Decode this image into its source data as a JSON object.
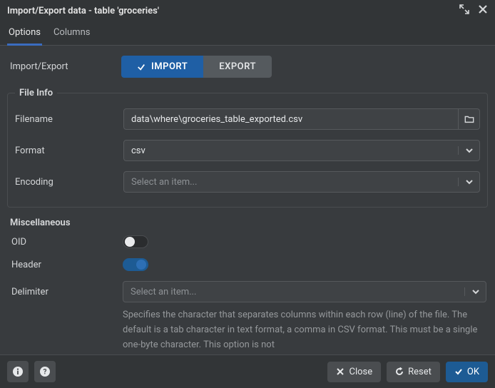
{
  "title": "Import/Export data - table 'groceries'",
  "tabs": {
    "options": "Options",
    "columns": "Columns",
    "active": "options"
  },
  "ie_label": "Import/Export",
  "seg": {
    "import": "IMPORT",
    "export": "EXPORT"
  },
  "file_info": {
    "legend": "File Info",
    "filename_label": "Filename",
    "filename_value": "data\\where\\groceries_table_exported.csv",
    "format_label": "Format",
    "format_value": "csv",
    "encoding_label": "Encoding",
    "encoding_placeholder": "Select an item..."
  },
  "misc": {
    "legend": "Miscellaneous",
    "oid_label": "OID",
    "header_label": "Header",
    "delimiter_label": "Delimiter",
    "delimiter_placeholder": "Select an item...",
    "delimiter_help": "Specifies the character that separates columns within each row (line) of the file. The default is a tab character in text format, a comma in CSV format. This must be a single one-byte character. This option is not"
  },
  "footer": {
    "close": "Close",
    "reset": "Reset",
    "ok": "OK"
  }
}
